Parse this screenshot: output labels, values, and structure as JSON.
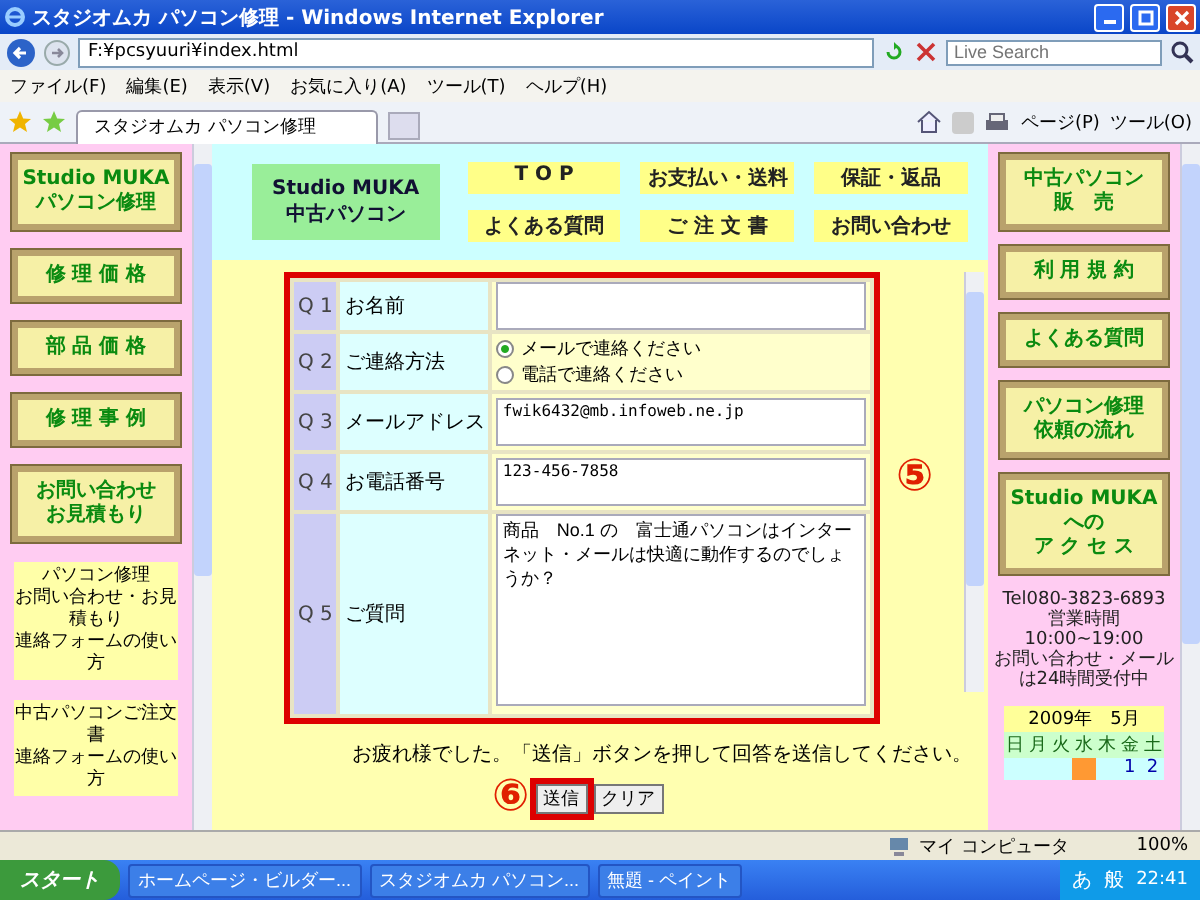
{
  "window": {
    "title": "スタジオムカ パソコン修理 - Windows Internet Explorer"
  },
  "address_bar": {
    "value": "F:¥pcsyuuri¥index.html"
  },
  "search": {
    "placeholder": "Live Search"
  },
  "menu": [
    "ファイル(F)",
    "編集(E)",
    "表示(V)",
    "お気に入り(A)",
    "ツール(T)",
    "ヘルプ(H)"
  ],
  "tab": {
    "label": "スタジオムカ パソコン修理"
  },
  "command_bar": [
    "ページ(P)",
    "ツール(O)"
  ],
  "left_sidebar": {
    "buttons": [
      {
        "lines": [
          "Studio MUKA",
          "パソコン修理"
        ]
      },
      {
        "lines": [
          "修 理 価 格"
        ]
      },
      {
        "lines": [
          "部 品 価 格"
        ]
      },
      {
        "lines": [
          "修 理 事 例"
        ]
      },
      {
        "lines": [
          "お問い合わせ",
          "お見積もり"
        ]
      }
    ],
    "notes": [
      {
        "lines": [
          "パソコン修理",
          "お問い合わせ・お見積もり",
          "連絡フォームの使い方"
        ]
      },
      {
        "lines": [
          "中古パソコンご注文書",
          "連絡フォームの使い方"
        ]
      }
    ]
  },
  "header": {
    "logo": [
      "Studio MUKA",
      "中古パソコン"
    ],
    "nav": [
      "T O P",
      "お支払い・送料",
      "保証・返品",
      "よくある質問",
      "ご 注 文 書",
      "お問い合わせ"
    ]
  },
  "form": {
    "rows": [
      {
        "number": "Q 1",
        "label": "お名前",
        "kind": "text",
        "value": ""
      },
      {
        "number": "Q 2",
        "label": "ご連絡方法",
        "kind": "radio",
        "options": [
          {
            "label": "メールで連絡ください",
            "selected": true
          },
          {
            "label": "電話で連絡ください",
            "selected": false
          }
        ]
      },
      {
        "number": "Q 3",
        "label": "メールアドレス",
        "kind": "text",
        "value": "fwik6432@mb.infoweb.ne.jp"
      },
      {
        "number": "Q 4",
        "label": "お電話番号",
        "kind": "text",
        "value": "123-456-7858"
      },
      {
        "number": "Q 5",
        "label": "ご質問",
        "kind": "textarea",
        "value": "商品　No.1 の　富士通パソコンはインターネット・メールは快適に動作するのでしょうか？"
      }
    ],
    "annotation": "⑤",
    "message": "お疲れ様でした。「送信」ボタンを押して回答を送信してください。",
    "step_mark": "⑥",
    "submit": "送信",
    "clear": "クリア"
  },
  "right_sidebar": {
    "buttons": [
      {
        "lines": [
          "中古パソコン",
          "販　売"
        ]
      },
      {
        "lines": [
          "利 用 規 約"
        ]
      },
      {
        "lines": [
          "よくある質問"
        ]
      },
      {
        "lines": [
          "パソコン修理",
          "依頼の流れ"
        ]
      },
      {
        "lines": [
          "Studio MUKA",
          "への",
          "ア ク セ ス"
        ]
      }
    ],
    "info": [
      "Tel080-3823-6893",
      "営業時間 10:00~19:00",
      "お問い合わせ・メールは24時間受付中"
    ],
    "calendar": {
      "title": "2009年　5月",
      "weekdays": [
        "日",
        "月",
        "火",
        "水",
        "木",
        "金",
        "土"
      ],
      "cells": [
        {
          "text": "",
          "highlighted": false
        },
        {
          "text": "",
          "highlighted": false
        },
        {
          "text": "",
          "highlighted": false
        },
        {
          "text": "",
          "highlighted": true
        },
        {
          "text": "",
          "highlighted": false
        },
        {
          "text": "1",
          "highlighted": false
        },
        {
          "text": "2",
          "highlighted": false
        }
      ]
    }
  },
  "status_bar": {
    "zone": "マイ コンピュータ",
    "zoom": "100%"
  },
  "taskbar": {
    "start": "スタート",
    "items": [
      "ホームページ・ビルダー...",
      "スタジオムカ パソコン...",
      "無題 - ペイント"
    ],
    "tray": [
      "あ",
      "般"
    ],
    "clock": "22:41"
  }
}
